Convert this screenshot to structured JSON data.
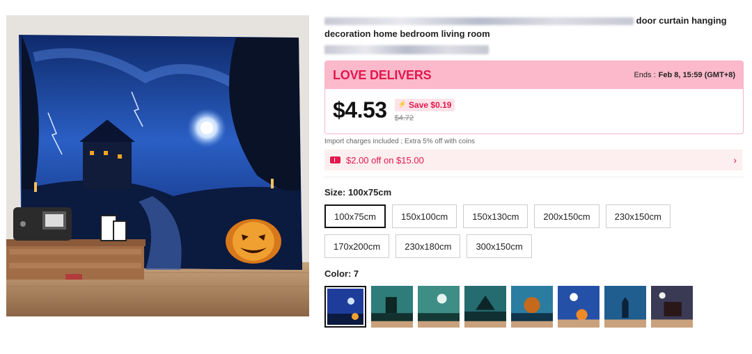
{
  "product": {
    "title_tail": "door curtain hanging",
    "title_line2": "decoration home bedroom living room"
  },
  "deal": {
    "name": "LOVE DELIVERS",
    "ends_label": "Ends :",
    "ends_value": "Feb 8, 15:59 (GMT+8)",
    "price": "$4.53",
    "save": "Save $0.19",
    "original_price": "$4.72",
    "accent": "#e4164c",
    "header_bg": "#fbb9cb"
  },
  "import_note": "Import charges included ; Extra 5% off with coins",
  "coupon": {
    "text": "$2.00 off on $15.00",
    "icon": "ticket-icon",
    "arrow": "›"
  },
  "size": {
    "label": "Size: 100x75cm",
    "options": [
      "100x75cm",
      "150x100cm",
      "150x130cm",
      "200x150cm",
      "230x150cm",
      "170x200cm",
      "230x180cm",
      "300x150cm"
    ],
    "selected": "100x75cm"
  },
  "color": {
    "label": "Color: 7",
    "swatch_count": 8,
    "selected_index": 0
  }
}
